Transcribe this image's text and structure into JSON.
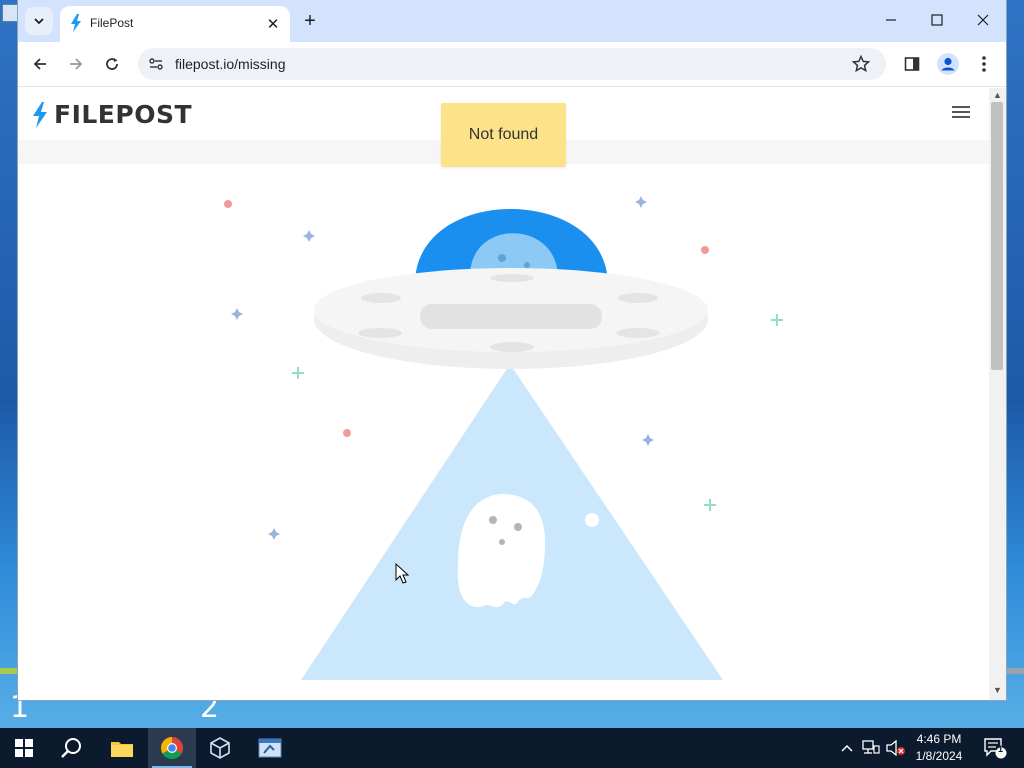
{
  "browser": {
    "tab_title": "FilePost",
    "url": "filepost.io/missing"
  },
  "site": {
    "logo_text": "FILEPOST",
    "toast": "Not found"
  },
  "desktop": {
    "labels": [
      "1",
      "2"
    ]
  },
  "taskbar": {
    "time": "4:46 PM",
    "date": "1/8/2024",
    "notification_count": "1"
  },
  "colors": {
    "brand": "#1a9af0",
    "toast_bg": "#fce38a",
    "beam": "#cbe7fb",
    "saucer_dome": "#1a8ff0"
  }
}
